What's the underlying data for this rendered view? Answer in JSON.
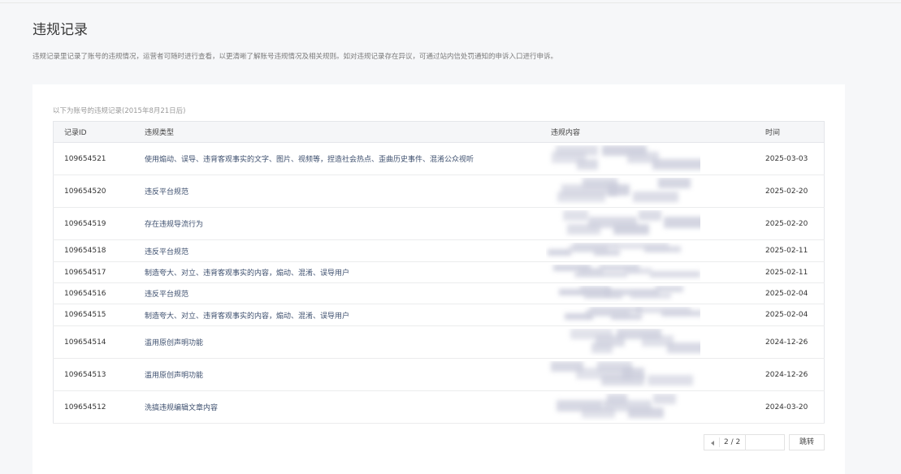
{
  "page": {
    "title": "违规记录",
    "description": "违规记录里记录了账号的违规情况，运营者可随时进行查看，以更清晰了解账号违规情况及相关规则。如对违规记录存在异议，可通过站内信处罚通知的申诉入口进行申诉。"
  },
  "records": {
    "caption": "以下为账号的违规记录(2015年8月21日后)",
    "headers": {
      "id": "记录ID",
      "type": "违规类型",
      "content": "违规内容",
      "time": "时间"
    },
    "rows": [
      {
        "id": "109654521",
        "type": "使用煽动、误导、违背客观事实的文字、图片、视频等，捏造社会热点、歪曲历史事件、混淆公众视听",
        "time": "2025-03-03"
      },
      {
        "id": "109654520",
        "type": "违反平台规范",
        "time": "2025-02-20"
      },
      {
        "id": "109654519",
        "type": "存在违规导流行为",
        "time": "2025-02-20"
      },
      {
        "id": "109654518",
        "type": "违反平台规范",
        "time": "2025-02-11"
      },
      {
        "id": "109654517",
        "type": "制造夸大、对立、违背客观事实的内容，煽动、混淆、误导用户",
        "time": "2025-02-11"
      },
      {
        "id": "109654516",
        "type": "违反平台规范",
        "time": "2025-02-04"
      },
      {
        "id": "109654515",
        "type": "制造夸大、对立、违背客观事实的内容，煽动、混淆、误导用户",
        "time": "2025-02-04"
      },
      {
        "id": "109654514",
        "type": "滥用原创声明功能",
        "time": "2024-12-26"
      },
      {
        "id": "109654513",
        "type": "滥用原创声明功能",
        "time": "2024-12-26"
      },
      {
        "id": "109654512",
        "type": "洗搞违规编辑文章内容",
        "time": "2024-03-20"
      }
    ]
  },
  "pagination": {
    "page_indicator": "2 / 2",
    "jump_label": "跳转",
    "jump_value": ""
  }
}
